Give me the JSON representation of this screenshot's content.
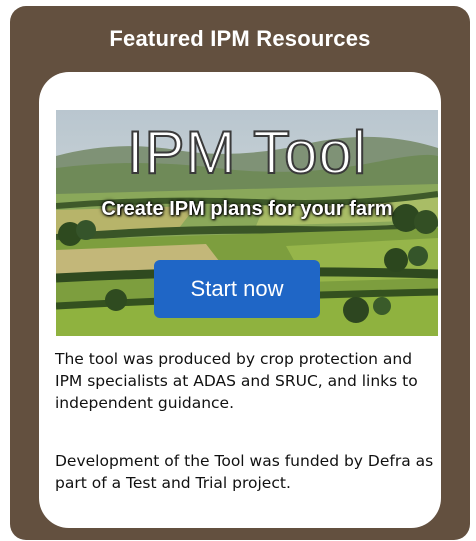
{
  "panel": {
    "title": "Featured IPM Resources",
    "background": "#63503f"
  },
  "banner": {
    "title": "IPM Tool",
    "subtitle": "Create IPM plans for your farm",
    "button_label": "Start now",
    "button_color": "#1f66c6",
    "image": "countryside-farmland-photo"
  },
  "description": {
    "paragraph1": "The tool was produced by crop protection and IPM specialists at ADAS and SRUC, and links to independent guidance.",
    "paragraph2": "Development of the Tool was funded by Defra as part of a Test and Trial project."
  }
}
